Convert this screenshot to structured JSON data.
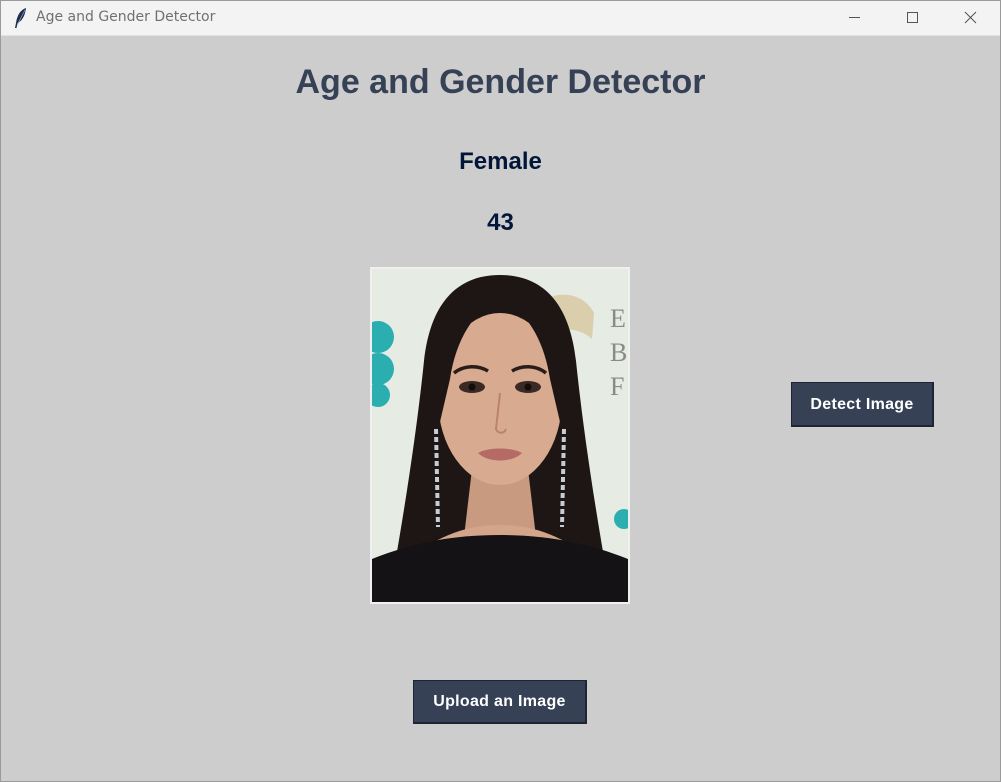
{
  "window": {
    "title": "Age and Gender Detector",
    "icon": "feather-icon",
    "controls": [
      "minimize-icon",
      "maximize-icon",
      "close-icon"
    ]
  },
  "main": {
    "heading": "Age and Gender Detector",
    "gender_result": "Female",
    "age_result": "43",
    "image_content": "uploaded portrait photo",
    "detect_button_label": "Detect Image",
    "upload_button_label": "Upload an Image"
  },
  "colors": {
    "background": "#cdcdcd",
    "heading": "#364156",
    "result_text": "#011638",
    "button_bg": "#364156",
    "button_text": "#ffffff"
  }
}
